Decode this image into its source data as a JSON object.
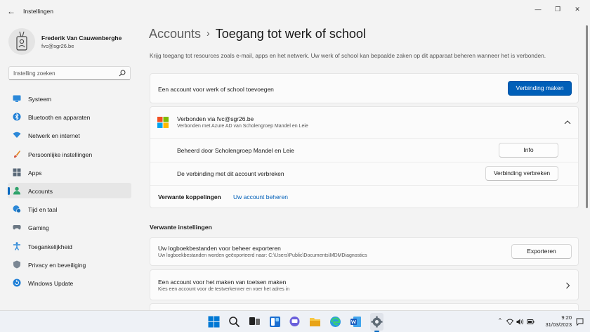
{
  "window": {
    "title": "Instellingen",
    "back_glyph": "←",
    "minimize_glyph": "—",
    "maximize_glyph": "❐",
    "close_glyph": "✕"
  },
  "profile": {
    "name": "Frederik Van Cauwenberghe",
    "email": "fvc@sgr26.be"
  },
  "search": {
    "placeholder": "Instelling zoeken"
  },
  "nav": {
    "items": [
      {
        "label": "Systeem",
        "icon": "monitor-icon"
      },
      {
        "label": "Bluetooth en apparaten",
        "icon": "bluetooth-icon"
      },
      {
        "label": "Netwerk en internet",
        "icon": "wifi-icon"
      },
      {
        "label": "Persoonlijke instellingen",
        "icon": "brush-icon"
      },
      {
        "label": "Apps",
        "icon": "apps-icon"
      },
      {
        "label": "Accounts",
        "icon": "person-icon",
        "selected": true
      },
      {
        "label": "Tijd en taal",
        "icon": "globe-clock-icon"
      },
      {
        "label": "Gaming",
        "icon": "gamepad-icon"
      },
      {
        "label": "Toegankelijkheid",
        "icon": "accessibility-icon"
      },
      {
        "label": "Privacy en beveiliging",
        "icon": "shield-icon"
      },
      {
        "label": "Windows Update",
        "icon": "update-icon"
      }
    ]
  },
  "main": {
    "breadcrumb_parent": "Accounts",
    "breadcrumb_separator": "›",
    "breadcrumb_current": "Toegang tot werk of school",
    "description": "Krijg toegang tot resources zoals e-mail, apps en het netwerk. Uw werk of school kan bepaalde zaken op dit apparaat beheren wanneer het is verbonden.",
    "add_account": {
      "label": "Een account voor werk of school toevoegen",
      "button": "Verbinding maken"
    },
    "connected": {
      "title": "Verbonden via fvc@sgr26.be",
      "subtitle": "Verbonden met Azure AD van Scholengroep Mandel en Leie",
      "managed_label": "Beheerd door Scholengroep Mandel en Leie",
      "info_button": "Info",
      "disconnect_label": "De verbinding met dit account verbreken",
      "disconnect_button": "Verbinding verbreken",
      "related_label": "Verwante koppelingen",
      "related_link": "Uw account beheren"
    },
    "related_settings": {
      "title": "Verwante instellingen",
      "export": {
        "label": "Uw logboekbestanden voor beheer exporteren",
        "subtitle": "Uw logboekbestanden worden geëxporteerd naar: C:\\Users\\Public\\Documents\\MDMDiagnostics",
        "button": "Exporteren"
      },
      "test_account": {
        "label": "Een account voor het maken van toetsen maken",
        "subtitle": "Kies een account voor de testverkenner en voer het adres in"
      }
    }
  },
  "taskbar": {
    "icons": [
      "windows-start-icon",
      "search-icon",
      "task-view-icon",
      "widgets-icon",
      "chat-icon",
      "file-explorer-icon",
      "edge-icon",
      "word-icon",
      "settings-icon"
    ],
    "chevron": "^",
    "time": "9:20",
    "date": "31/03/2023"
  },
  "colors": {
    "accent": "#005fb8",
    "background": "#f3f3f3",
    "card": "#fbfbfb"
  }
}
